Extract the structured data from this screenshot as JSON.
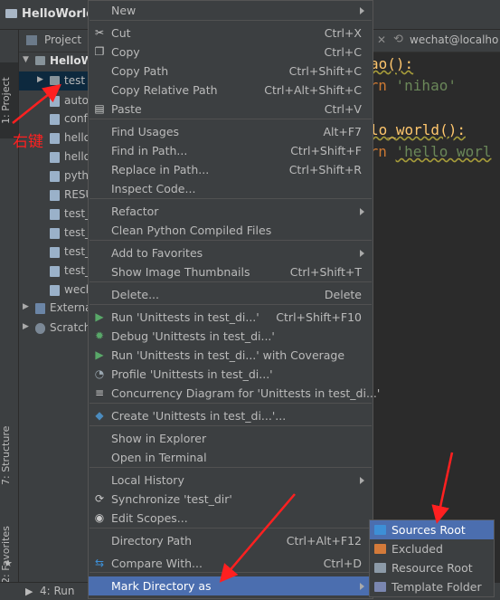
{
  "window": {
    "title": "HelloWorld"
  },
  "left_tabs": {
    "project": "1: Project",
    "structure": "7: Structure",
    "favorites": "2: Favorites"
  },
  "project_panel": {
    "header": "Project",
    "tree": [
      {
        "label": "HelloW",
        "kind": "root"
      },
      {
        "label": "test",
        "kind": "folder",
        "selected": true
      },
      {
        "label": "autom",
        "kind": "file"
      },
      {
        "label": "conf",
        "kind": "file"
      },
      {
        "label": "hello",
        "kind": "file"
      },
      {
        "label": "hello",
        "kind": "file"
      },
      {
        "label": "pytho",
        "kind": "file"
      },
      {
        "label": "RESU",
        "kind": "file"
      },
      {
        "label": "test_",
        "kind": "file"
      },
      {
        "label": "test_",
        "kind": "file"
      },
      {
        "label": "test_",
        "kind": "file"
      },
      {
        "label": "test_",
        "kind": "file"
      },
      {
        "label": "wech",
        "kind": "file"
      },
      {
        "label": "Externa",
        "kind": "lib"
      },
      {
        "label": "Scratch",
        "kind": "scratch"
      }
    ]
  },
  "annotation": {
    "right_click": "右键"
  },
  "editor": {
    "tab_label": "wechat@localho",
    "lines": [
      {
        "a": "ao():",
        "b": ""
      },
      {
        "a": "urn ",
        "b": "'nihao'"
      },
      {
        "a": "lo_world():",
        "b": ""
      },
      {
        "a": "urn ",
        "b": "'hello worl"
      }
    ]
  },
  "bottom_bar": {
    "run": "4: Run"
  },
  "context_menu": {
    "items": [
      {
        "label": "New",
        "shortcut": "",
        "submenu": true,
        "icon": ""
      },
      {
        "label": "Cut",
        "shortcut": "Ctrl+X",
        "icon": "scissors-icon"
      },
      {
        "label": "Copy",
        "shortcut": "Ctrl+C",
        "icon": "copy-icon"
      },
      {
        "label": "Copy Path",
        "shortcut": "Ctrl+Shift+C",
        "icon": ""
      },
      {
        "label": "Copy Relative Path",
        "shortcut": "Ctrl+Alt+Shift+C",
        "icon": ""
      },
      {
        "label": "Paste",
        "shortcut": "Ctrl+V",
        "icon": "paste-icon"
      },
      {
        "label": "Find Usages",
        "shortcut": "Alt+F7",
        "icon": ""
      },
      {
        "label": "Find in Path...",
        "shortcut": "Ctrl+Shift+F",
        "icon": ""
      },
      {
        "label": "Replace in Path...",
        "shortcut": "Ctrl+Shift+R",
        "icon": ""
      },
      {
        "label": "Inspect Code...",
        "shortcut": "",
        "icon": ""
      },
      {
        "label": "Refactor",
        "shortcut": "",
        "submenu": true,
        "icon": ""
      },
      {
        "label": "Clean Python Compiled Files",
        "shortcut": "",
        "icon": ""
      },
      {
        "label": "Add to Favorites",
        "shortcut": "",
        "submenu": true,
        "icon": ""
      },
      {
        "label": "Show Image Thumbnails",
        "shortcut": "Ctrl+Shift+T",
        "icon": ""
      },
      {
        "label": "Delete...",
        "shortcut": "Delete",
        "icon": ""
      },
      {
        "label": "Run 'Unittests in test_di...'",
        "shortcut": "Ctrl+Shift+F10",
        "icon": "run-icon"
      },
      {
        "label": "Debug 'Unittests in test_di...'",
        "shortcut": "",
        "icon": "debug-icon"
      },
      {
        "label": "Run 'Unittests in test_di...' with Coverage",
        "shortcut": "",
        "icon": "coverage-icon"
      },
      {
        "label": "Profile 'Unittests in test_di...'",
        "shortcut": "",
        "icon": "profile-icon"
      },
      {
        "label": "Concurrency Diagram for 'Unittests in test_di...'",
        "shortcut": "",
        "icon": "concurrency-icon"
      },
      {
        "label": "Create 'Unittests in test_di...'...",
        "shortcut": "",
        "icon": "python-icon"
      },
      {
        "label": "Show in Explorer",
        "shortcut": "",
        "icon": ""
      },
      {
        "label": "Open in Terminal",
        "shortcut": "",
        "icon": ""
      },
      {
        "label": "Local History",
        "shortcut": "",
        "submenu": true,
        "icon": ""
      },
      {
        "label": "Synchronize 'test_dir'",
        "shortcut": "",
        "icon": "sync-icon"
      },
      {
        "label": "Edit Scopes...",
        "shortcut": "",
        "icon": "scopes-icon"
      },
      {
        "label": "Directory Path",
        "shortcut": "Ctrl+Alt+F12",
        "icon": ""
      },
      {
        "label": "Compare With...",
        "shortcut": "Ctrl+D",
        "icon": "compare-icon"
      },
      {
        "label": "Mark Directory as",
        "shortcut": "",
        "submenu": true,
        "icon": "",
        "highlighted": true
      }
    ]
  },
  "submenu": {
    "items": [
      {
        "label": "Sources Root",
        "color": "#3d8fd6",
        "highlighted": true
      },
      {
        "label": "Excluded",
        "color": "#d37a3a"
      },
      {
        "label": "Resource Root",
        "color": "#8c9aa8"
      },
      {
        "label": "Template Folder",
        "color": "#7a86b0"
      }
    ]
  },
  "colors": {
    "accent": "#4b6eaf",
    "annotation": "#ff2020"
  }
}
